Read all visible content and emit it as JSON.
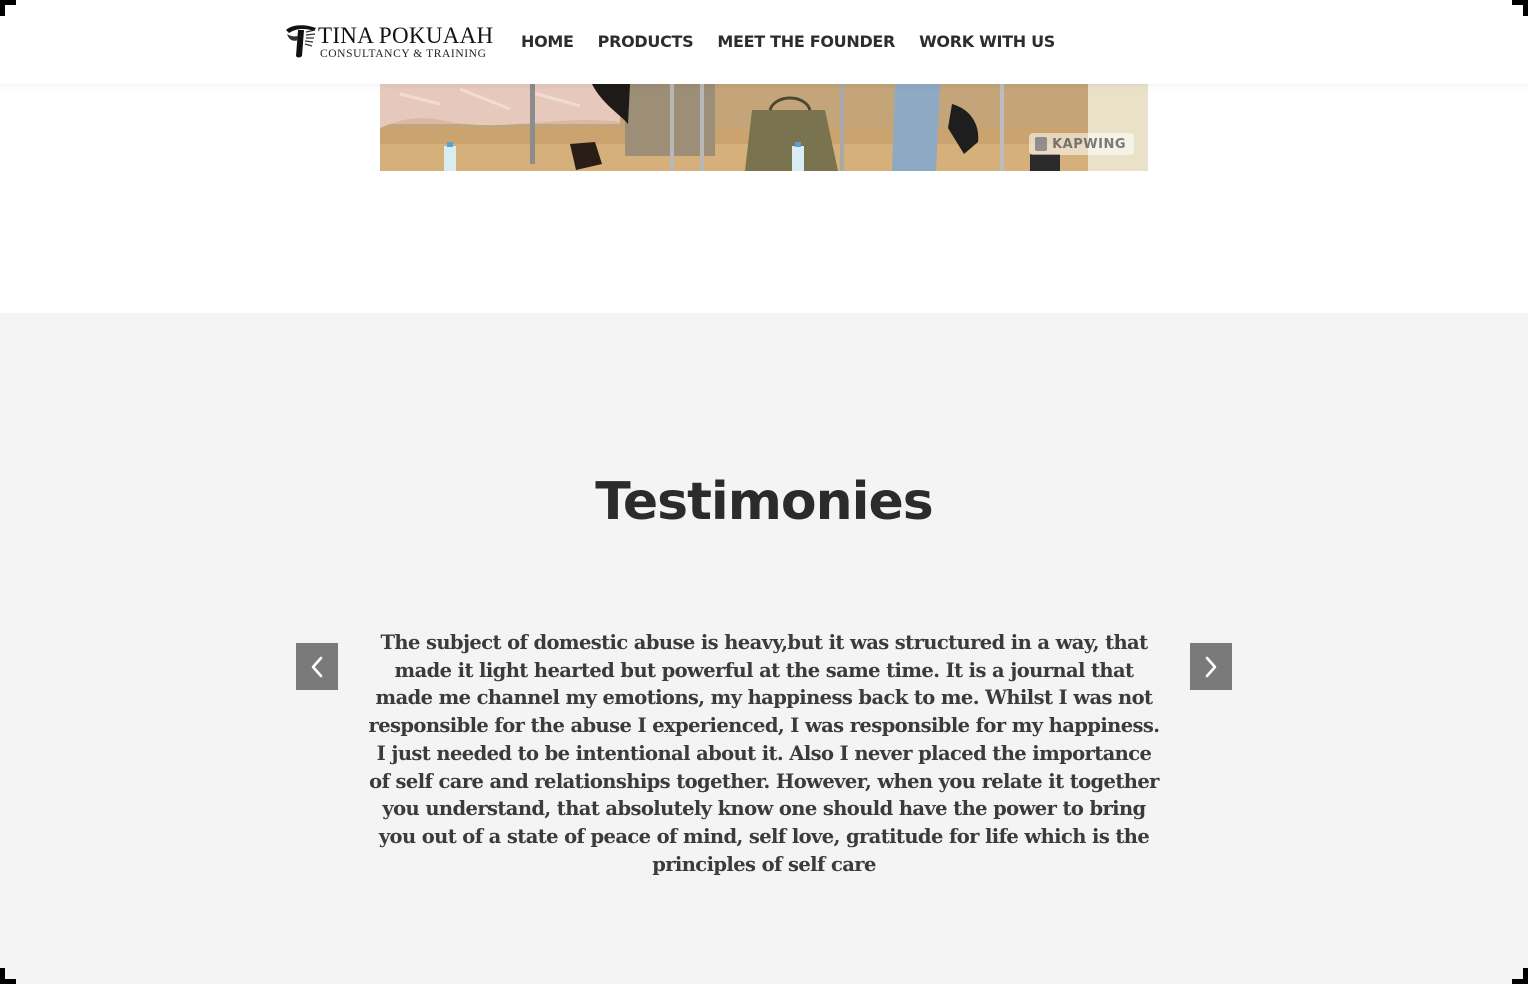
{
  "header": {
    "logo": {
      "title": "TINA POKUAAH",
      "subtitle": "CONSULTANCY & TRAINING",
      "icon": "tp-logo-icon"
    },
    "nav": [
      {
        "label": "HOME"
      },
      {
        "label": "PRODUCTS"
      },
      {
        "label": "MEET THE FOUNDER"
      },
      {
        "label": "WORK WITH US"
      }
    ]
  },
  "video": {
    "watermark": "KAPWING"
  },
  "testimonies": {
    "title": "Testimonies",
    "prev_icon": "chevron-left-icon",
    "next_icon": "chevron-right-icon",
    "quote": "The subject of domestic abuse is heavy,but it was structured in a way, that made it light hearted but powerful at the same time. It is a journal that made me channel my emotions, my happiness back to me. Whilst I was not responsible for the abuse I experienced, I was responsible for my happiness. I just needed to be intentional about it. Also I never placed the importance of self care and relationships together. However, when you relate it together you understand, that absolutely know one should have the power to bring you out of a state of peace of mind, self love, gratitude for life which is the principles of self care"
  },
  "colors": {
    "section_bg": "#f4f4f4",
    "arrow_bg": "#7a7a7a",
    "heading": "#2b2b2b",
    "text": "#3b3b3b"
  }
}
